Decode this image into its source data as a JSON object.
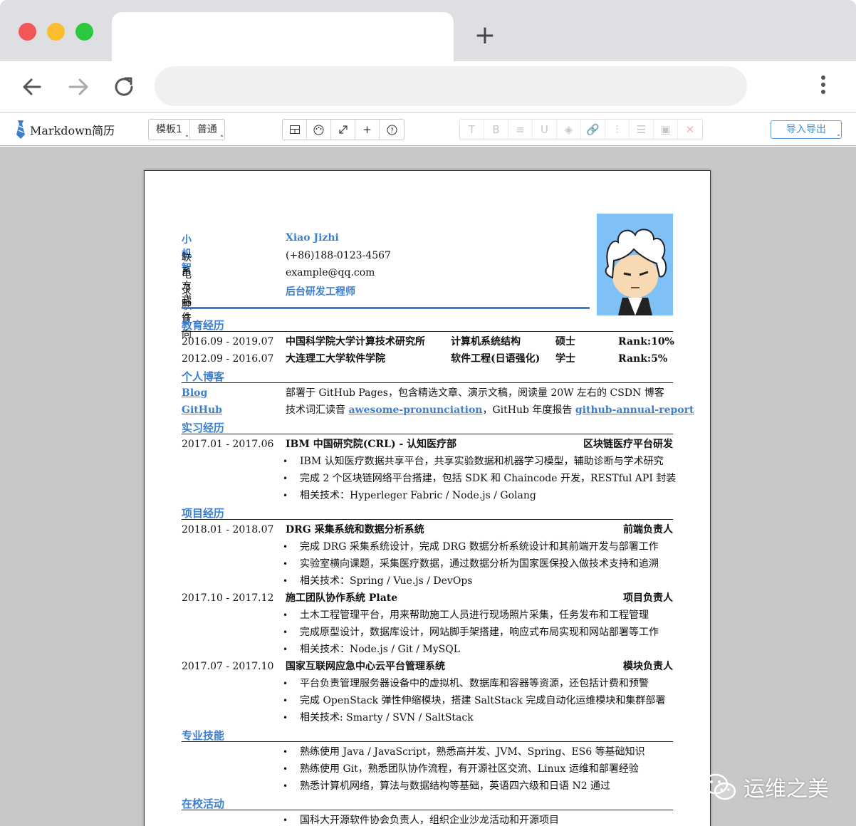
{
  "app": {
    "logo_text": "Markdown简历",
    "template_label": "模板1",
    "mode_label": "普通",
    "io_label": "导入导出"
  },
  "toolbar": {
    "view_icons": [
      "layout-icon",
      "palette-icon",
      "fullscreen-icon",
      "plus-icon",
      "help-icon"
    ],
    "format_icons": [
      "text-icon",
      "bold-icon",
      "list-icon",
      "underline-icon",
      "fill-icon",
      "link-icon",
      "align-icon",
      "center-icon",
      "image-icon",
      "delete-icon"
    ],
    "format_glyphs": [
      "T",
      "B",
      "≡",
      "U",
      "◈",
      "🔗",
      "⫶",
      "☰",
      "▣",
      "✕"
    ]
  },
  "resume": {
    "name_cn": "小机智",
    "name_en": "Xiao Jizhi",
    "contact_label": "联系方式",
    "contact_value": "(+86)188-0123-4567",
    "email_label": "电子邮件",
    "email_value": "example@qq.com",
    "job_label": "求职意向",
    "job_value": "后台研发工程师",
    "sections": {
      "education": "教育经历",
      "blog": "个人博客",
      "intern": "实习经历",
      "projects": "项目经历",
      "skills": "专业技能",
      "campus": "在校活动"
    },
    "education": [
      {
        "date": "2016.09 - 2019.07",
        "school": "中国科学院大学计算技术研究所",
        "major": "计算机系统结构",
        "degree": "硕士",
        "rank": "Rank:10%"
      },
      {
        "date": "2012.09 - 2016.07",
        "school": "大连理工大学软件学院",
        "major": "软件工程(日语强化)",
        "degree": "学士",
        "rank": "Rank:5%"
      }
    ],
    "blog": {
      "blog_label": "Blog",
      "blog_text": "部署于 GitHub Pages，包含精选文章、演示文稿，阅读量 20W 左右的 CSDN 博客",
      "github_label": "GitHub",
      "github_text1": "技术词汇读音 ",
      "github_link1": "awesome-pronunciation",
      "github_text2": "，GitHub 年度报告 ",
      "github_link2": "github-annual-report"
    },
    "intern": {
      "date": "2017.01 - 2017.06",
      "title": "IBM 中国研究院(CRL) - 认知医疗部",
      "role": "区块链医疗平台研发",
      "bullets": [
        "IBM 认知医疗数据共享平台，共享实验数据和机器学习模型，辅助诊断与学术研究",
        "完成 2 个区块链网络平台搭建，包括 SDK 和 Chaincode 开发，RESTful API 封装",
        "相关技术：Hyperleger Fabric / Node.js / Golang"
      ]
    },
    "projects": [
      {
        "date": "2018.01 - 2018.07",
        "title": "DRG 采集系统和数据分析系统",
        "role": "前端负责人",
        "bullets": [
          "完成 DRG 采集系统设计，完成 DRG 数据分析系统设计和其前端开发与部署工作",
          "实验室横向课题，采集医疗数据，通过数据分析为国家医保投入做技术支持和追溯",
          "相关技术：Spring / Vue.js / DevOps"
        ]
      },
      {
        "date": "2017.10 - 2017.12",
        "title": "施工团队协作系统 Plate",
        "role": "项目负责人",
        "bullets": [
          "土木工程管理平台，用来帮助施工人员进行现场照片采集，任务发布和工程管理",
          "完成原型设计，数据库设计，网站脚手架搭建，响应式布局实现和网站部署等工作",
          "相关技术：Node.js / Git / MySQL"
        ]
      },
      {
        "date": "2017.07 - 2017.10",
        "title": "国家互联网应急中心云平台管理系统",
        "role": "模块负责人",
        "bullets": [
          "平台负责管理服务器设备中的虚拟机、数据库和容器等资源，还包括计费和预警",
          "完成 OpenStack 弹性伸缩模块，搭建 SaltStack 完成自动化运维模块和集群部署",
          "相关技术: Smarty / SVN / SaltStack"
        ]
      }
    ],
    "skills": [
      "熟练使用 Java / JavaScript，熟悉高并发、JVM、Spring、ES6 等基础知识",
      "熟练使用 Git，熟悉团队协作流程，有开源社区交流、Linux 运维和部署经验",
      "熟悉计算机网络，算法与数据结构等基础，英语四六级和日语 N2 通过"
    ],
    "campus": [
      "国科大开源软件协会负责人，组织企业沙龙活动和开源项目"
    ]
  },
  "watermark": "运维之美",
  "colors": {
    "accent": "#3d7fcf",
    "tab_strip": "#dedfe3",
    "workspace": "#c8c8c8"
  }
}
